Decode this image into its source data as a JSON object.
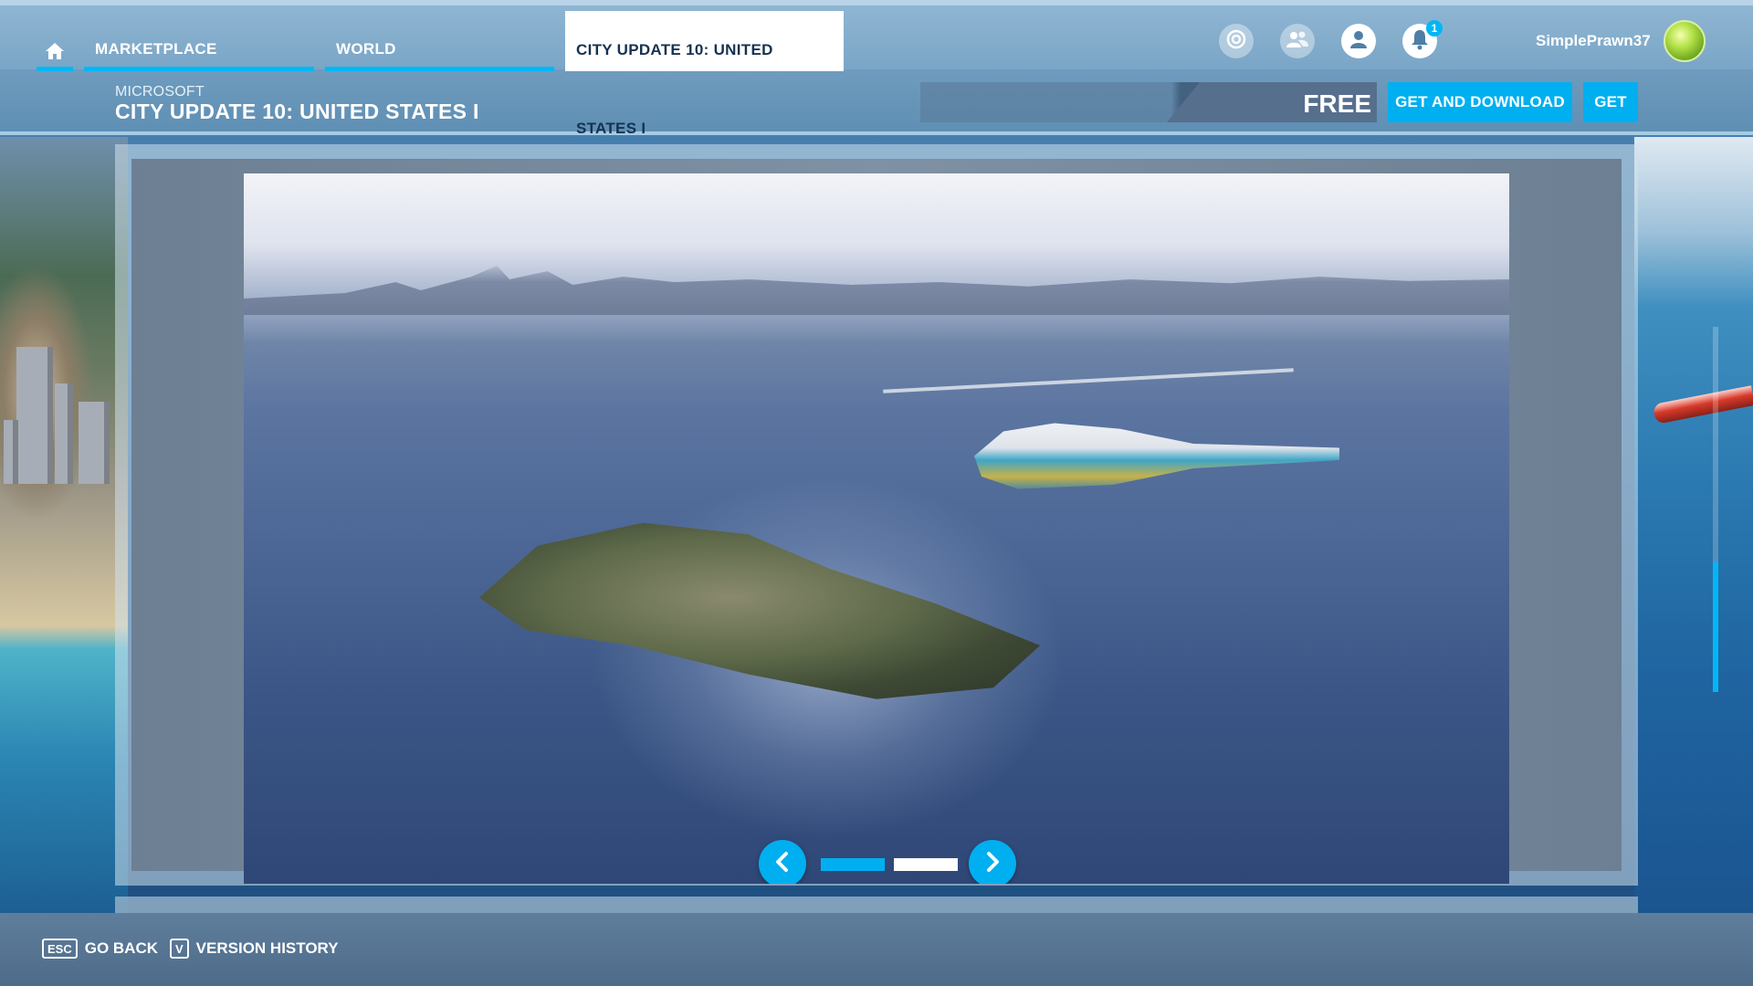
{
  "nav": {
    "home_icon": "home-icon",
    "tabs": [
      {
        "label": "MARKETPLACE",
        "active": false
      },
      {
        "label": "WORLD",
        "active": false
      },
      {
        "label": "CITY UPDATE 10: UNITED STATES I",
        "active": true
      }
    ],
    "icons": [
      "activity-icon",
      "friends-icon",
      "profile-icon",
      "notifications-icon"
    ],
    "notification_count": "1",
    "username": "SimplePrawn37"
  },
  "product": {
    "publisher": "MICROSOFT",
    "title": "CITY UPDATE 10: UNITED STATES I",
    "price": "FREE",
    "get_and_download_label": "GET AND DOWNLOAD",
    "get_label": "GET"
  },
  "gallery": {
    "image_count": 2,
    "current_index": 1
  },
  "footer": {
    "go_back_key": "ESC",
    "go_back_label": "GO BACK",
    "version_history_key": "V",
    "version_history_label": "VERSION HISTORY"
  },
  "colors": {
    "accent": "#00b7f6",
    "button": "#00aff0"
  }
}
